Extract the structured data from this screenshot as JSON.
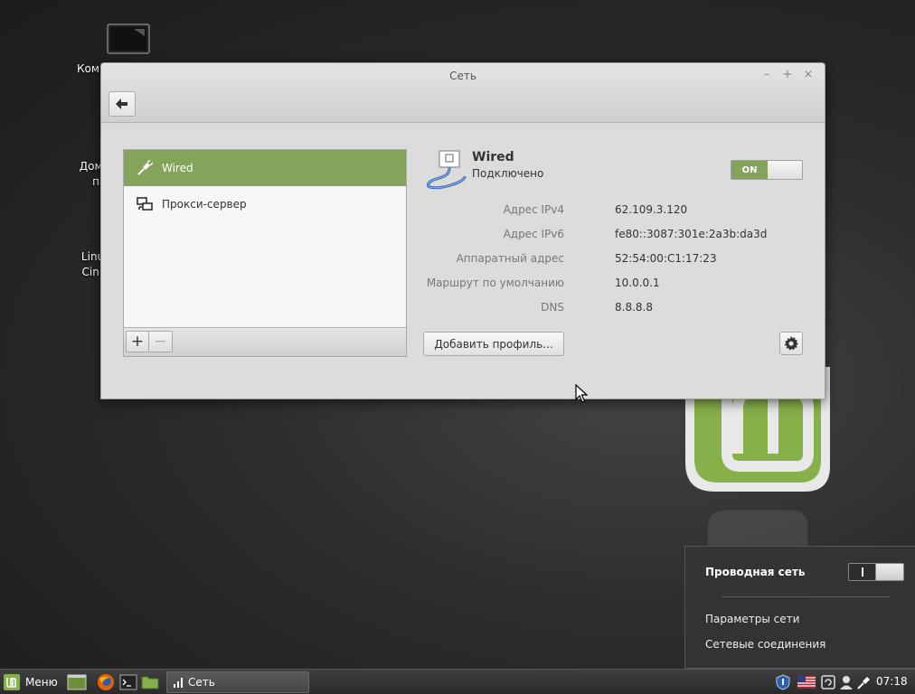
{
  "desktop": {
    "icons": [
      {
        "label1": "Компьютер",
        "label2": ""
      },
      {
        "label1": "Домашняя папка",
        "label2": ""
      },
      {
        "label1": "Linux Mint",
        "label2": "Cinnamon"
      }
    ]
  },
  "window": {
    "title": "Сеть",
    "controls": {
      "minimize": "–",
      "maximize": "+",
      "close": "×"
    }
  },
  "connections": {
    "items": [
      {
        "label": "Wired",
        "icon": "wired-plug-icon",
        "selected": true
      },
      {
        "label": "Прокси-сервер",
        "icon": "proxy-network-icon",
        "selected": false
      }
    ],
    "add_label": "+",
    "remove_label": "−"
  },
  "details": {
    "name": "Wired",
    "status": "Подключено",
    "toggle_label": "ON",
    "rows": [
      {
        "label": "Адрес IPv4",
        "value": "62.109.3.120"
      },
      {
        "label": "Адрес IPv6",
        "value": "fe80::3087:301e:2a3b:da3d"
      },
      {
        "label": "Аппаратный адрес",
        "value": "52:54:00:C1:17:23"
      },
      {
        "label": "Маршрут по умолчанию",
        "value": "10.0.0.1"
      },
      {
        "label": "DNS",
        "value": "8.8.8.8"
      }
    ],
    "add_profile_label": "Добавить профиль..."
  },
  "network_popup": {
    "title": "Проводная сеть",
    "switch_on": false,
    "items": [
      "Параметры сети",
      "Сетевые соединения"
    ]
  },
  "panel": {
    "menu_label": "Меню",
    "task_label": "Сеть",
    "clock": "07:18"
  },
  "colors": {
    "accent": "#84a45c",
    "panel": "#333333"
  }
}
